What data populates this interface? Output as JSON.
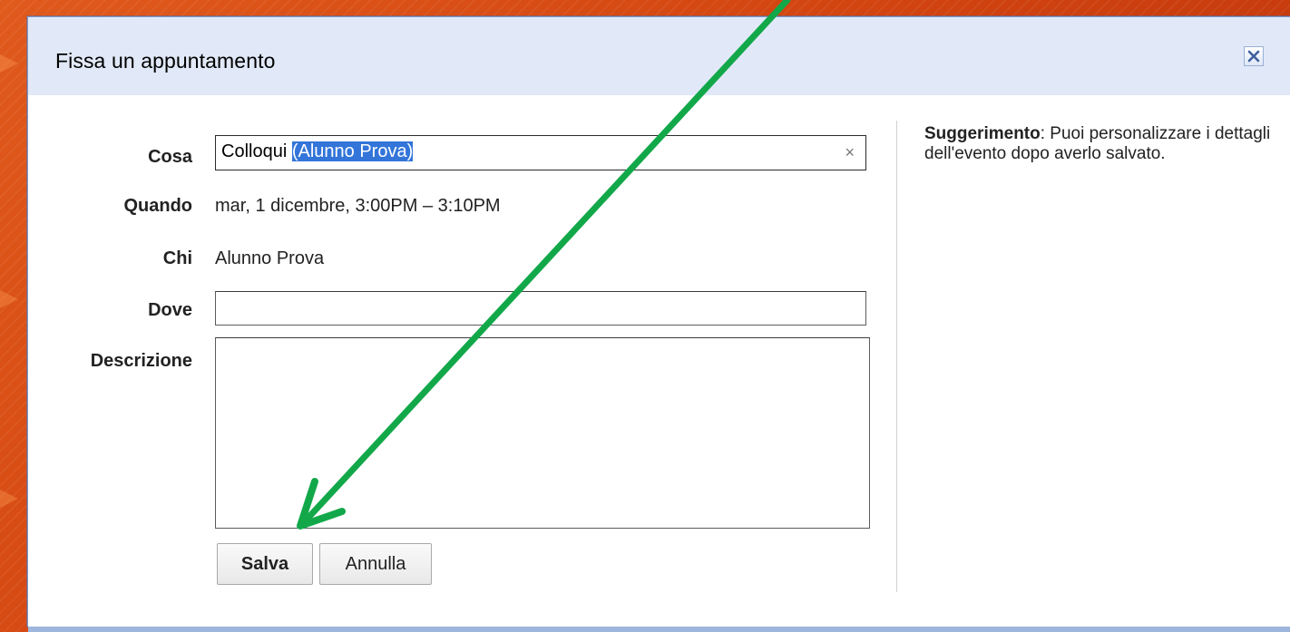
{
  "dialog": {
    "title": "Fissa un appuntamento",
    "close_icon": "close-icon"
  },
  "form": {
    "cosa_label": "Cosa",
    "cosa_value_plain": "Colloqui ",
    "cosa_value_selected": "(Alunno Prova)",
    "clear_glyph": "×",
    "quando_label": "Quando",
    "quando_value": "mar, 1 dicembre, 3:00PM – 3:10PM",
    "chi_label": "Chi",
    "chi_value": "Alunno Prova",
    "dove_label": "Dove",
    "dove_value": "",
    "descrizione_label": "Descrizione",
    "descrizione_value": ""
  },
  "buttons": {
    "save_label": "Salva",
    "cancel_label": "Annulla"
  },
  "tip": {
    "title": "Suggerimento",
    "text": ": Puoi personalizzare i dettagli dell'evento dopo averlo salvato."
  },
  "colors": {
    "background": "#d24410",
    "header": "#e1e9f8",
    "selection": "#3375d9",
    "annotation_arrow": "#12a84a"
  }
}
